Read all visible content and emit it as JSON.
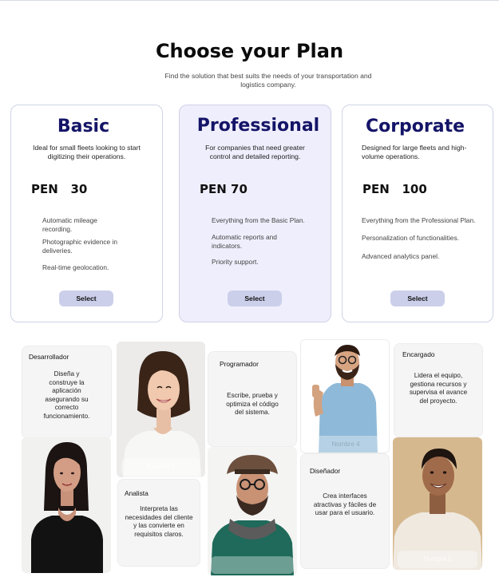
{
  "header": {
    "title": "Choose your Plan",
    "subtitle_line1": "Find the solution that best suits the needs of your transportation and",
    "subtitle_line2": "logistics company."
  },
  "plans": [
    {
      "name": "Basic",
      "desc_line1": "Ideal for small fleets looking to start",
      "desc_line2": "digitizing their operations.",
      "price": "PEN   30",
      "features": [
        {
          "l1": "Automatic mileage",
          "l2": "recording."
        },
        {
          "l1": "Photographic evidence in",
          "l2": "deliveries."
        },
        {
          "l1": "Real-time geolocation.",
          "l2": ""
        }
      ],
      "button": "Select"
    },
    {
      "name": "Professional",
      "desc_line1": "For companies that need greater",
      "desc_line2": "control and detailed reporting.",
      "price": "PEN 70",
      "features": [
        {
          "l1": "Everything from the Basic Plan.",
          "l2": ""
        },
        {
          "l1": "Automatic reports and",
          "l2": "indicators."
        },
        {
          "l1": "Priority support.",
          "l2": ""
        }
      ],
      "button": "Select"
    },
    {
      "name": "Corporate",
      "desc_line1": "Designed for large fleets and high-",
      "desc_line2": "volume operations.",
      "price": "PEN   100",
      "features": [
        {
          "l1": "Everything from the Professional Plan.",
          "l2": ""
        },
        {
          "l1": "Personalization of functionalities.",
          "l2": ""
        },
        {
          "l1": "Advanced analytics panel.",
          "l2": ""
        }
      ],
      "button": "Select"
    }
  ],
  "team": {
    "desarrollador": {
      "role": "Desarrollador",
      "d1": "Diseña y",
      "d2": "construye la",
      "d3": "aplicación",
      "d4": "asegurando su",
      "d5": "correcto",
      "d6": "funcionamiento."
    },
    "programador": {
      "role": "Programador",
      "d1": "Escribe, prueba y",
      "d2": "optimiza el código",
      "d3": "del sistema."
    },
    "encargado": {
      "role": "Encargado",
      "d1": "Lidera el equipo,",
      "d2": "gestiona recursos y",
      "d3": "supervisa el avance",
      "d4": "del proyecto."
    },
    "analista": {
      "role": "Analista",
      "d1": "Interpreta las",
      "d2": "necesidades del cliente",
      "d3": "y las convierte en",
      "d4": "requisitos claros."
    },
    "disenador": {
      "role": "Diseñador",
      "d1": "Crea interfaces",
      "d2": "atractivas y fáciles de",
      "d3": "usar para el usuario."
    },
    "nameplates": {
      "n2": "Nombre 2",
      "n4": "Nombre 4",
      "n6": "Nombre 6"
    }
  }
}
